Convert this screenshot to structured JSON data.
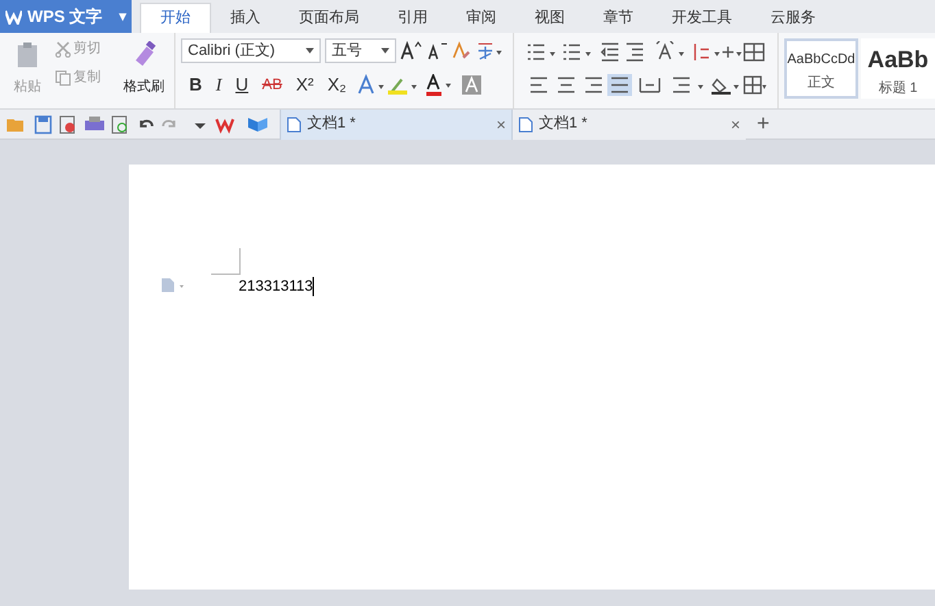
{
  "app_menu": {
    "label": "WPS 文字",
    "caret": "▾"
  },
  "menu_tabs": [
    {
      "label": "开始",
      "selected": true
    },
    {
      "label": "插入",
      "selected": false
    },
    {
      "label": "页面布局",
      "selected": false
    },
    {
      "label": "引用",
      "selected": false
    },
    {
      "label": "审阅",
      "selected": false
    },
    {
      "label": "视图",
      "selected": false
    },
    {
      "label": "章节",
      "selected": false
    },
    {
      "label": "开发工具",
      "selected": false
    },
    {
      "label": "云服务",
      "selected": false
    }
  ],
  "clipboard": {
    "paste": {
      "label": "粘贴",
      "disabled": true
    },
    "cut": {
      "label": "剪切",
      "disabled": true
    },
    "copy": {
      "label": "复制",
      "disabled": true
    },
    "format_painter": {
      "label": "格式刷",
      "disabled": false
    }
  },
  "font": {
    "name": "Calibri (正文)",
    "size": "五号"
  },
  "format_buttons": [
    "B",
    "I",
    "U",
    "AB",
    "X²",
    "X₂"
  ],
  "styles": [
    {
      "sample": "AaBbCcDd",
      "label": "正文",
      "selected": true
    },
    {
      "sample": "AaBb",
      "label": "标题 1",
      "selected": false
    }
  ],
  "doc_tabs": [
    {
      "title": "文档1 *",
      "selected": true,
      "close": "×"
    },
    {
      "title": "文档1 *",
      "selected": false,
      "close": "×"
    }
  ],
  "new_tab": "+",
  "document": {
    "text": "213313113"
  }
}
